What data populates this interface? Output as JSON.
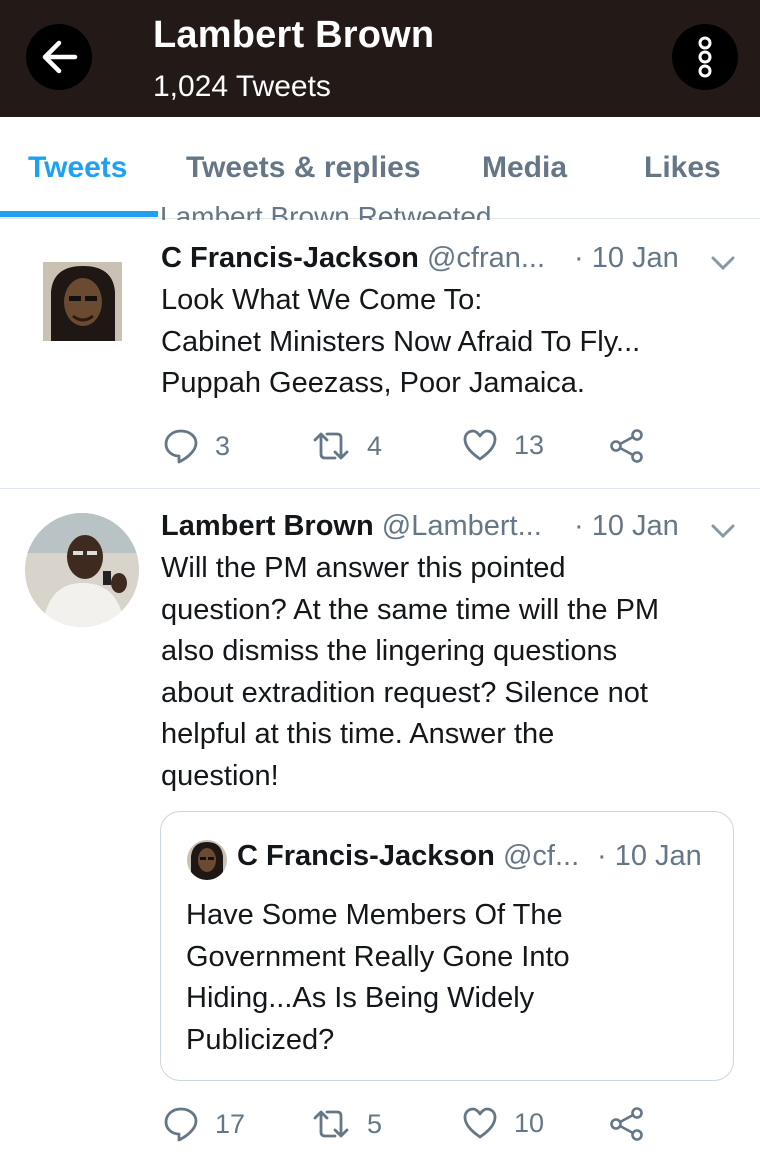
{
  "header": {
    "title": "Lambert Brown",
    "subtitle": "1,024 Tweets"
  },
  "tabs": [
    {
      "label": "Tweets",
      "active": true
    },
    {
      "label": "Tweets & replies",
      "active": false
    },
    {
      "label": "Media",
      "active": false
    },
    {
      "label": "Likes",
      "active": false
    }
  ],
  "retweet_label": "Lambert Brown Retweeted",
  "tweets": [
    {
      "name": "C Francis-Jackson",
      "handle": "@cfran...",
      "date": "· 10 Jan",
      "text": [
        "Look What We Come To:",
        "Cabinet Ministers Now Afraid To Fly...",
        "Puppah Geezass, Poor Jamaica."
      ],
      "replies": "3",
      "retweets": "4",
      "likes": "13"
    },
    {
      "name": "Lambert Brown",
      "handle": "@Lambert...",
      "date": "· 10 Jan",
      "text": [
        "Will the PM answer this pointed",
        "question? At the same time will the PM",
        "also dismiss the lingering questions",
        "about extradition request? Silence not",
        "helpful at this time. Answer the",
        "question!"
      ],
      "replies": "17",
      "retweets": "5",
      "likes": "10",
      "quote": {
        "name": "C Francis-Jackson",
        "handle": "@cf...",
        "date": "· 10 Jan",
        "text": [
          "Have Some Members Of The",
          "Government Really Gone Into",
          "Hiding...As Is Being Widely",
          "Publicized?"
        ]
      }
    }
  ],
  "colors": {
    "header_bg": "#231a17",
    "accent": "#1da1f2",
    "secondary_text": "#657786"
  },
  "icons": {
    "back": "arrow-left-icon",
    "more": "more-vertical-icon",
    "reply": "reply-icon",
    "retweet": "retweet-icon",
    "like": "heart-icon",
    "share": "share-icon",
    "caret": "chevron-down-icon"
  }
}
